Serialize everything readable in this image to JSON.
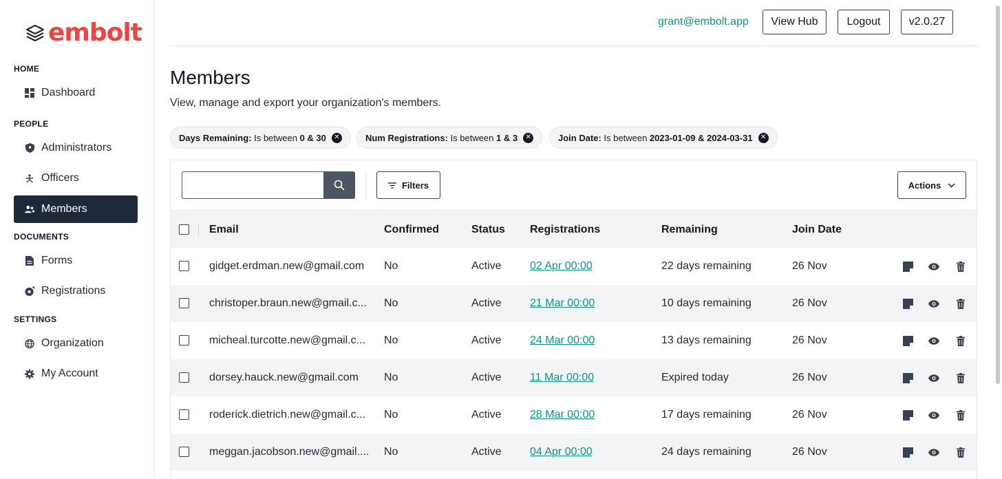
{
  "brand": {
    "name": "embolt"
  },
  "sidebar": {
    "sections": {
      "home": "HOME",
      "people": "PEOPLE",
      "documents": "DOCUMENTS",
      "settings": "SETTINGS"
    },
    "items": {
      "dashboard": "Dashboard",
      "administrators": "Administrators",
      "officers": "Officers",
      "members": "Members",
      "forms": "Forms",
      "registrations": "Registrations",
      "organization": "Organization",
      "my_account": "My Account"
    },
    "active": "members"
  },
  "topbar": {
    "email": "grant@embolt.app",
    "view_hub": "View Hub",
    "logout": "Logout",
    "version": "v2.0.27"
  },
  "page": {
    "title": "Members",
    "subtitle": "View, manage and export your organization's members."
  },
  "filters": [
    {
      "label": "Days Remaining:",
      "op": " Is between ",
      "value": "0 & 30"
    },
    {
      "label": "Num Registrations:",
      "op": " Is between ",
      "value": "1 & 3"
    },
    {
      "label": "Join Date:",
      "op": " Is between ",
      "value": "2023-01-09 & 2024-03-31"
    }
  ],
  "toolbar": {
    "search_placeholder": "",
    "filters_label": "Filters",
    "actions_label": "Actions"
  },
  "table": {
    "columns": {
      "email": "Email",
      "confirmed": "Confirmed",
      "status": "Status",
      "registrations": "Registrations",
      "remaining": "Remaining",
      "join_date": "Join Date"
    },
    "rows": [
      {
        "email": "gidget.erdman.new@gmail.com",
        "confirmed": "No",
        "status": "Active",
        "registration": "02 Apr 00:00",
        "remaining": "22 days remaining",
        "join_date": "26 Nov"
      },
      {
        "email": "christoper.braun.new@gmail.c...",
        "confirmed": "No",
        "status": "Active",
        "registration": "21 Mar 00:00",
        "remaining": "10 days remaining",
        "join_date": "26 Nov"
      },
      {
        "email": "micheal.turcotte.new@gmail.c...",
        "confirmed": "No",
        "status": "Active",
        "registration": "24 Mar 00:00",
        "remaining": "13 days remaining",
        "join_date": "26 Nov"
      },
      {
        "email": "dorsey.hauck.new@gmail.com",
        "confirmed": "No",
        "status": "Active",
        "registration": "11 Mar 00:00",
        "remaining": "Expired today",
        "join_date": "26 Nov"
      },
      {
        "email": "roderick.dietrich.new@gmail.c...",
        "confirmed": "No",
        "status": "Active",
        "registration": "28 Mar 00:00",
        "remaining": "17 days remaining",
        "join_date": "26 Nov"
      },
      {
        "email": "meggan.jacobson.new@gmail....",
        "confirmed": "No",
        "status": "Active",
        "registration": "04 Apr 00:00",
        "remaining": "24 days remaining",
        "join_date": "26 Nov"
      }
    ]
  },
  "colors": {
    "brand": "#ef4444",
    "accent": "#0d9488",
    "sidebar_active": "#1e2a3b"
  }
}
